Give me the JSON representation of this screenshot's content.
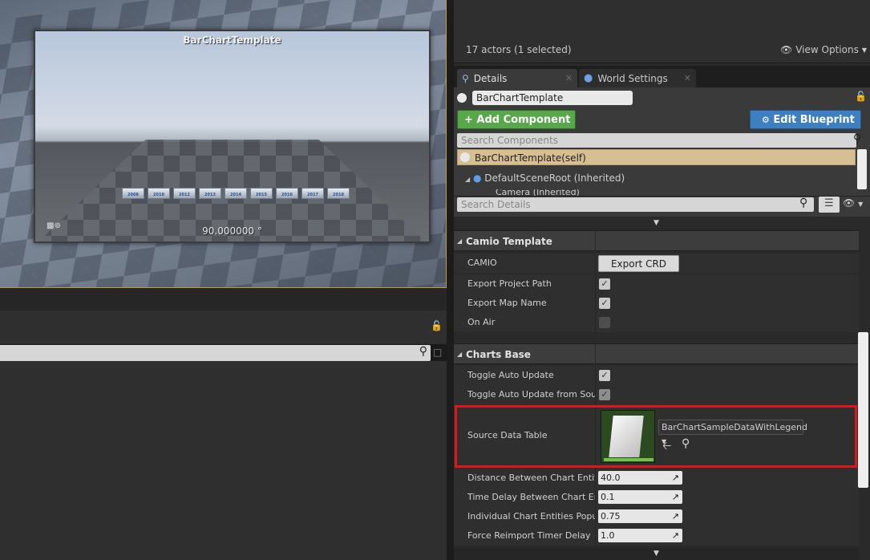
{
  "viewport": {
    "frame_title": "BarChartTemplate",
    "rotation_readout": "90.000000 °",
    "block_labels": [
      "2008",
      "2010",
      "2012",
      "2013",
      "2014",
      "2015",
      "2016",
      "2017",
      "2018"
    ]
  },
  "outliner": {
    "actor_count": "17 actors (1 selected)",
    "view_options": "View Options"
  },
  "tabs": [
    {
      "label": "Details"
    },
    {
      "label": "World Settings"
    }
  ],
  "details": {
    "actor_name": "BarChartTemplate",
    "add_component": "+ Add Component",
    "edit_blueprint": "Edit Blueprint",
    "search_components_placeholder": "Search Components",
    "self_component": "BarChartTemplate(self)",
    "root_component": "DefaultSceneRoot (Inherited)",
    "camera_component": "Camera (Inherited)",
    "search_details_placeholder": "Search Details"
  },
  "camio_section": {
    "title": "Camio Template",
    "rows": [
      {
        "name": "CAMIO",
        "button": "Export CRD file..."
      },
      {
        "name": "Export Project Path",
        "checked": true
      },
      {
        "name": "Export Map Name",
        "checked": true
      },
      {
        "name": "On Air",
        "checked": false
      }
    ]
  },
  "charts_section": {
    "title": "Charts Base",
    "toggle_auto_update": {
      "name": "Toggle Auto Update",
      "checked": true
    },
    "toggle_from_source": {
      "name": "Toggle Auto Update from Source",
      "checked": true
    },
    "source_data_table": {
      "name": "Source Data Table",
      "value": "BarChartSampleDataWithLegend"
    },
    "numeric_rows": [
      {
        "name": "Distance Between Chart Entities",
        "value": "40.0"
      },
      {
        "name": "Time Delay Between Chart Entities",
        "value": "0.1"
      },
      {
        "name": "Individual Chart Entities Popup Delay",
        "value": "0.75"
      },
      {
        "name": "Force Reimport Timer Delay",
        "value": "1.0"
      }
    ]
  },
  "colors": {
    "highlight_border": "#e0161a",
    "add_component_green": "#58a74a",
    "edit_blueprint_blue": "#3e7fc1",
    "selected_row": "#d7bf94"
  }
}
